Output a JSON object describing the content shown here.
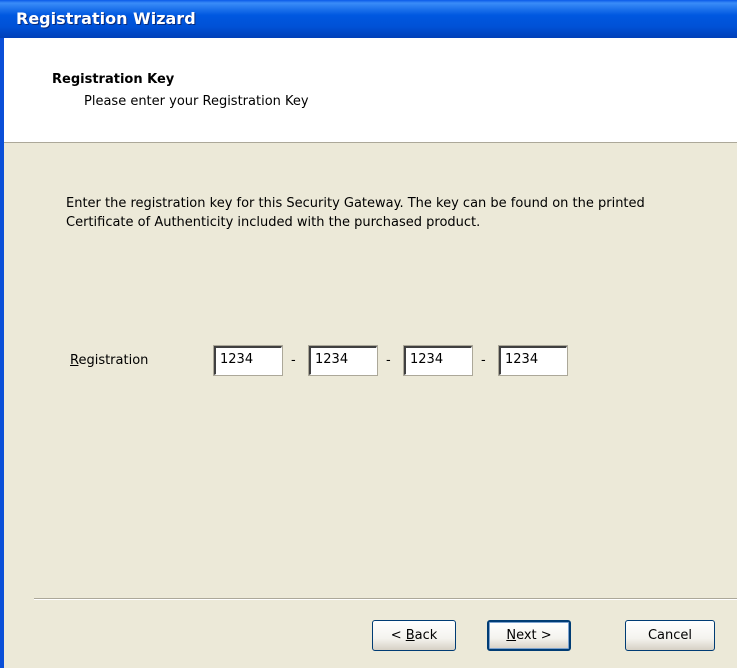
{
  "window": {
    "title": "Registration Wizard"
  },
  "header": {
    "title": "Registration Key",
    "subtitle": "Please enter your Registration Key"
  },
  "main": {
    "description": "Enter the registration key for this Security Gateway. The key can be found on the printed Certificate of Authenticity included with the purchased product.",
    "registration_label_first": "R",
    "registration_label_rest": "egistration",
    "key_fields": [
      "1234",
      "1234",
      "1234",
      "1234"
    ],
    "separator": "-"
  },
  "buttons": {
    "back_prefix": "< ",
    "back_underline": "B",
    "back_rest": "ack",
    "next_underline": "N",
    "next_rest": "ext >",
    "cancel": "Cancel"
  }
}
